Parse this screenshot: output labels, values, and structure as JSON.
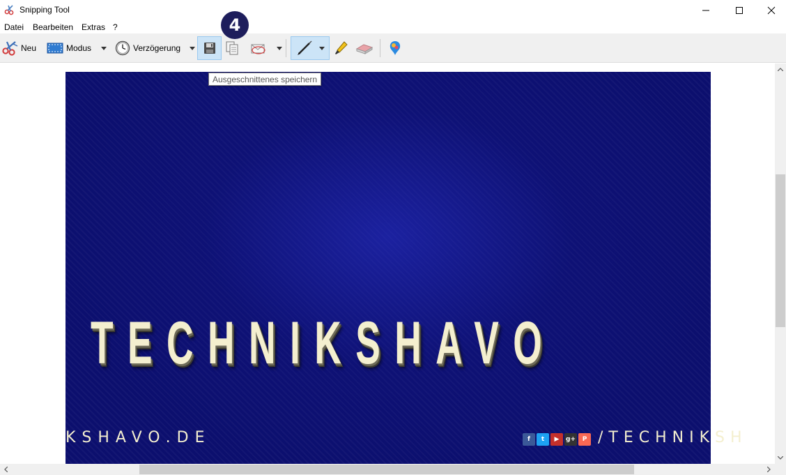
{
  "window": {
    "title": "Snipping Tool"
  },
  "menu": {
    "items": [
      "Datei",
      "Bearbeiten",
      "Extras",
      "?"
    ]
  },
  "toolbar": {
    "new_label": "Neu",
    "mode_label": "Modus",
    "delay_label": "Verzögerung",
    "tooltip": "Ausgeschnittenes speichern",
    "icons": [
      "scissors-icon",
      "mode-rect-icon",
      "clock-icon",
      "save-disk-icon",
      "copy-icon",
      "send-mail-icon",
      "pen-icon",
      "highlighter-icon",
      "eraser-icon",
      "paint3d-icon"
    ]
  },
  "step_badge": "4",
  "snip": {
    "headline": "TECHNIKSHAVO",
    "footer_left": "KSHAVO.DE",
    "footer_right": "/TECHNIKSH",
    "social_icons": [
      "facebook-icon",
      "twitter-icon",
      "youtube-icon",
      "google-plus-icon",
      "patreon-icon"
    ],
    "colors": {
      "background": "#0c0f6e",
      "text": "#f4efcf"
    }
  },
  "colors": {
    "selected_tool": "#cce4f7",
    "badge": "#1e1e5c",
    "toolbar_bg": "#f0f0f0"
  }
}
